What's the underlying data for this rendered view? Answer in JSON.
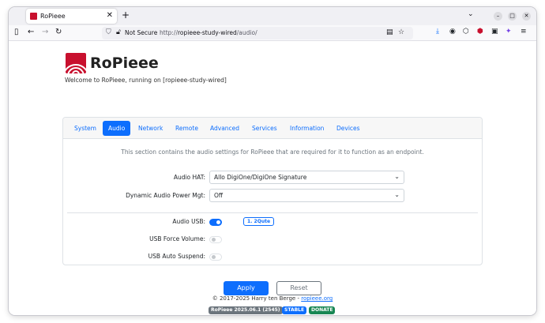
{
  "browser": {
    "tab_title": "RoPieee",
    "tab_close": "✕",
    "new_tab": "+",
    "list_tabs": "⌄",
    "minimize": "–",
    "maximize": "□",
    "close": "✕",
    "security_label": "Not Secure",
    "url_prefix": "http://",
    "url_host": "ropieee-study-wired",
    "url_path": "/audio/"
  },
  "page": {
    "brand": "RoPieee",
    "welcome": "Welcome to RoPieee, running on [ropieee-study-wired]",
    "tabs": [
      {
        "label": "System"
      },
      {
        "label": "Audio"
      },
      {
        "label": "Network"
      },
      {
        "label": "Remote"
      },
      {
        "label": "Advanced"
      },
      {
        "label": "Services"
      },
      {
        "label": "Information"
      },
      {
        "label": "Devices"
      }
    ],
    "active_tab": "Audio",
    "description": "This section contains the audio settings for RoPieee that are required for it to function as an endpoint.",
    "settings": {
      "audio_hat_label": "Audio HAT:",
      "audio_hat_value": "Allo DigiOne/DigiOne Signature",
      "power_mgt_label": "Dynamic Audio Power Mgt:",
      "power_mgt_value": "Off",
      "audio_usb_label": "Audio USB:",
      "audio_usb_on": true,
      "audio_usb_device": "1. 2Qute",
      "usb_force_volume_label": "USB Force Volume:",
      "usb_force_volume_on": false,
      "usb_auto_suspend_label": "USB Auto Suspend:",
      "usb_auto_suspend_on": false
    },
    "buttons": {
      "apply": "Apply",
      "reset": "Reset"
    },
    "footer": {
      "copyright": "© 2017-2025 Harry ten Berge - ",
      "link": "ropieee.org",
      "version_badge": "RoPieee 2025.06.1 (2545)",
      "stable_badge": "STABLE",
      "donate_badge": "DONATE"
    }
  },
  "colors": {
    "primary": "#0d6efd",
    "brand_red": "#c8102e",
    "version_badge": "#6c757d",
    "donate_badge": "#198754"
  }
}
